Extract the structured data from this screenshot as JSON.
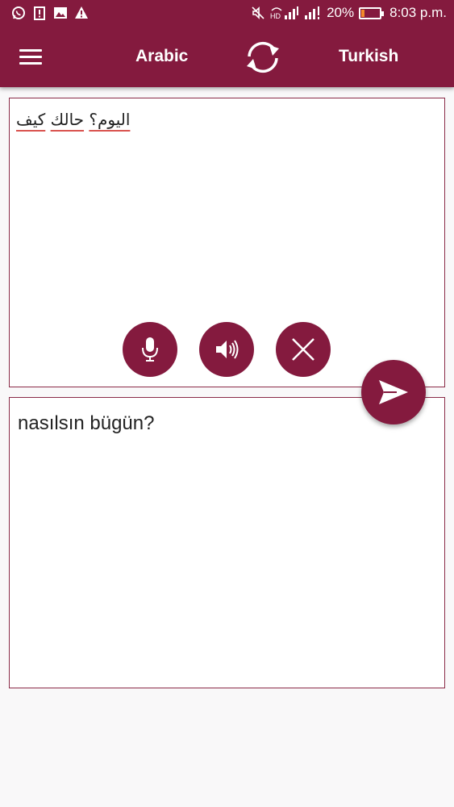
{
  "status_bar": {
    "battery_percent": "20%",
    "time": "8:03 p.m.",
    "left_icons": [
      "whatsapp-icon",
      "clipboard-alert-icon",
      "image-icon",
      "warning-icon"
    ],
    "right_icons": [
      "mute-icon",
      "hd-signal-icon",
      "signal-icon",
      "signal-icon",
      "battery-icon"
    ],
    "battery_level": 0.2
  },
  "toolbar": {
    "menu_icon": "hamburger-menu-icon",
    "source_language": "Arabic",
    "swap_icon": "swap-arrows-icon",
    "target_language": "Turkish"
  },
  "source": {
    "text": "كيف حالك اليوم؟",
    "words": [
      "كيف",
      "حالك",
      "اليوم؟"
    ]
  },
  "actions": {
    "mic_icon": "microphone-icon",
    "speak_icon": "speaker-icon",
    "clear_icon": "close-icon",
    "send_icon": "send-icon"
  },
  "target": {
    "text": "nasılsın bügün?"
  },
  "colors": {
    "primary": "#841a3e",
    "panel_border": "#8a2a47",
    "spell_underline": "#d9534f"
  }
}
